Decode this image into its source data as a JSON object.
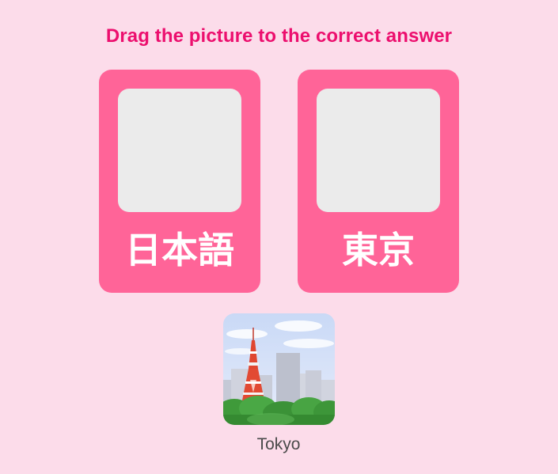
{
  "instruction": "Drag the picture to the correct answer",
  "answers": [
    {
      "label": "日本語"
    },
    {
      "label": "東京"
    }
  ],
  "draggable": {
    "caption": "Tokyo",
    "image": "tokyo-tower-icon"
  },
  "colors": {
    "background": "#fcdcea",
    "accent_text": "#ec0f6e",
    "card": "#ff6498",
    "slot": "#ebebeb"
  }
}
